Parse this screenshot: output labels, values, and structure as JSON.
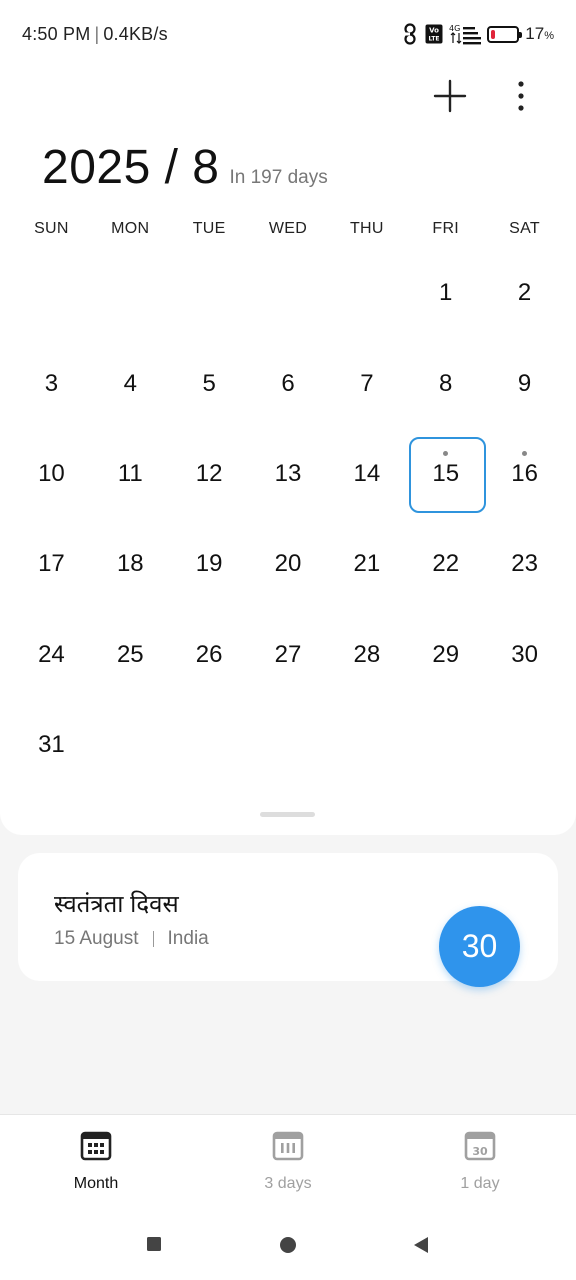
{
  "status_bar": {
    "time": "4:50 PM",
    "speed": "0.4KB/s",
    "network_label": "4G",
    "volte_label": "Vo LTE",
    "battery_percent": 17,
    "battery_text": "17",
    "battery_unit": "%"
  },
  "header": {
    "month_title": "2025 / 8",
    "days_away": "In 197 days"
  },
  "weekdays": [
    "SUN",
    "MON",
    "TUE",
    "WED",
    "THU",
    "FRI",
    "SAT"
  ],
  "weeks": [
    [
      "",
      "",
      "",
      "",
      "",
      "1",
      "2"
    ],
    [
      "3",
      "4",
      "5",
      "6",
      "7",
      "8",
      "9"
    ],
    [
      "10",
      "11",
      "12",
      "13",
      "14",
      "15",
      "16"
    ],
    [
      "17",
      "18",
      "19",
      "20",
      "21",
      "22",
      "23"
    ],
    [
      "24",
      "25",
      "26",
      "27",
      "28",
      "29",
      "30"
    ],
    [
      "31",
      "",
      "",
      "",
      "",
      "",
      ""
    ]
  ],
  "today": "15",
  "event_days": [
    "15",
    "16"
  ],
  "event": {
    "title": "स्वतंत्रता दिवस",
    "date": "15 August",
    "region": "India"
  },
  "fab": {
    "label": "30"
  },
  "bottom_nav": {
    "month": "Month",
    "three_days": "3 days",
    "one_day": "1 day",
    "one_day_icon_number": "30"
  },
  "colors": {
    "accent": "#2f94ec",
    "today_border": "#2f94dd",
    "inactive": "#a0a0a0",
    "battery_low": "#e0243a"
  }
}
